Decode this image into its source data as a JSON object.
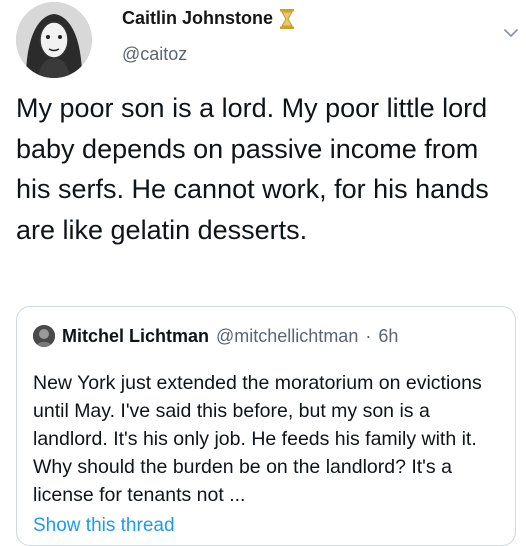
{
  "author": {
    "display_name": "Caitlin Johnstone",
    "handle": "@caitoz",
    "badge_icon": "hourglass-icon"
  },
  "tweet": {
    "text": "My poor son is a lord. My poor little lord baby depends on passive income from his serfs. He cannot work, for his hands are like gelatin desserts."
  },
  "quoted_tweet": {
    "display_name": "Mitchel Lichtman",
    "handle": "@mitchellichtman",
    "separator": "·",
    "time": "6h",
    "text": "New York just extended the moratorium on evictions until May. I've said this before, but my son is a landlord. It's his only job. He feeds his family with it. Why should the burden be on the landlord? It's a license for tenants not ...",
    "show_thread_label": "Show this thread"
  },
  "colors": {
    "link": "#1d9bf0",
    "secondary_text": "#5b6470",
    "border": "#cfd9de",
    "badge": "#c9a227"
  }
}
